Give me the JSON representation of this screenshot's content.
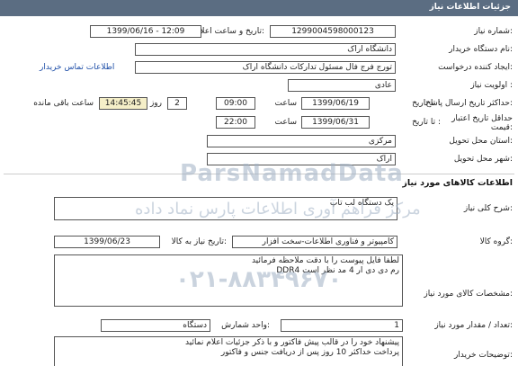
{
  "header": {
    "title": "جزئیات اطلاعات نیاز"
  },
  "fields": {
    "need_number_label": "شماره نیاز:",
    "need_number": "1299004598000123",
    "announce_label": "تاریخ و ساعت اعلان عمومی:",
    "announce_value": "1399/06/16 - 12:09",
    "buyer_label": "نام دستگاه خریدار:",
    "buyer_value": "دانشگاه اراک",
    "creator_label": "ایجاد کننده درخواست:",
    "creator_value": "تورج فرج فال مسئول تداركات دانشگاه اراک",
    "contact_link": "اطلاعات تماس خریدار",
    "priority_label": "اولویت نیاز :",
    "priority_value": "عادی",
    "send_deadline_label": "حداکثر تاریخ ارسال پاسخ:",
    "until_label_1": "تا تاریخ :",
    "send_date": "1399/06/19",
    "time_label_1": "ساعت",
    "send_time": "09:00",
    "days_count": "2",
    "days_label": "روز و",
    "remaining_time": "14:45:45",
    "remaining_label": "ساعت باقی مانده",
    "price_validity_label": "حداقل تاریخ اعتبار قیمت:",
    "until_label_2": "تا تاریخ :",
    "price_date": "1399/06/31",
    "time_label_2": "ساعت",
    "price_time": "22:00",
    "province_label": "استان محل تحویل:",
    "province_value": "مرکزی",
    "city_label": "شهر محل تحویل:",
    "city_value": "اراک"
  },
  "goods": {
    "section_title": "اطلاعات کالاهای مورد نیاز",
    "summary_label": "شرح کلی نیاز:",
    "summary_value": "یک دستگاه لب تاپ",
    "group_label": "گروه کالا:",
    "group_value": "کامپیوتر و فناوری اطلاعات-سخت افزار",
    "need_date_label": "تاریخ نیاز به کالا:",
    "need_date": "1399/06/23",
    "spec_label": "مشخصات کالای مورد نیاز:",
    "spec_line1": "لطفا فایل پیوست را با دقت ملاحظه فرمائید",
    "spec_line2": "رم دی دی ار 4 مد نظر است DDR4",
    "qty_label": "تعداد / مقدار مورد نیاز:",
    "qty_value": "1",
    "unit_label": "واحد شمارش:",
    "unit_value": "دستگاه",
    "notes_label": "توضیحات خریدار:",
    "notes_line1": "پیشنهاد خود را در قالب پیش فاکتور و با ذکر جزئیات اعلام نمائید",
    "notes_line2": "پرداخت خداکثر 10 روز پس از دریافت جنس و فاکتور"
  },
  "watermark": {
    "brand": "ParsNamadData",
    "slogan": "مرکز فراهم آوری اطلاعات پارس نماد داده",
    "phone": "۰۲۱-۸۸۳۴۹۶۷۰"
  }
}
